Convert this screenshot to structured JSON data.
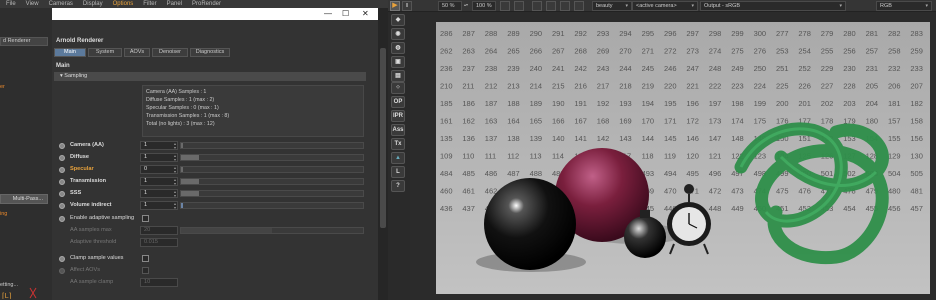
{
  "menubar": {
    "items": [
      {
        "label": "File",
        "active": false
      },
      {
        "label": "View",
        "active": false
      },
      {
        "label": "Cameras",
        "active": false
      },
      {
        "label": "Display",
        "active": false
      },
      {
        "label": "Options",
        "active": true
      },
      {
        "label": "Filter",
        "active": false
      },
      {
        "label": "Panel",
        "active": false
      },
      {
        "label": "ProRender",
        "active": false
      }
    ]
  },
  "left_strip": {
    "renderer_dropdown": "d Renderer",
    "orange_text_1": "er",
    "multipass_button": "Multi-Pass...",
    "orange_text_2": "ing",
    "bottom_text": "etting..."
  },
  "dialog": {
    "window_buttons": {
      "minimize": "—",
      "maximize": "☐",
      "close": "✕"
    },
    "title": "Arnold Renderer",
    "tabs": [
      {
        "label": "Main",
        "active": true
      },
      {
        "label": "System",
        "active": false
      },
      {
        "label": "AOVs",
        "active": false
      },
      {
        "label": "Denoiser",
        "active": false
      },
      {
        "label": "Diagnostics",
        "active": false
      }
    ],
    "main_label": "Main",
    "section_header": "▾ Sampling",
    "info_lines": [
      "Camera (AA) Samples : 1",
      "Diffuse Samples : 1 (max : 2)",
      "Specular Samples : 0 (max : 1)",
      "Transmission Samples : 1 (max : 8)",
      "Total (no lights) : 3 (max : 12)"
    ],
    "params": [
      {
        "label": "Camera (AA)",
        "value": "1",
        "fill": 0.0,
        "color": "gray"
      },
      {
        "label": "Diffuse",
        "value": "1",
        "fill": 0.1,
        "color": "gray"
      },
      {
        "label": "Specular",
        "value": "0",
        "fill": 0.0,
        "color": "gray"
      },
      {
        "label": "Transmission",
        "value": "1",
        "fill": 0.1,
        "color": "gray"
      },
      {
        "label": "SSS",
        "value": "1",
        "fill": 0.1,
        "color": "gray"
      },
      {
        "label": "Volume indirect",
        "value": "1",
        "fill": 0.01,
        "color": "blue"
      }
    ],
    "adaptive_label": "Enable adaptive sampling",
    "aa_samples_max_label": "AA samples max",
    "aa_samples_max_value": "20",
    "adaptive_threshold_label": "Adaptive threshold",
    "adaptive_threshold_value": "0.015",
    "clamp_label": "Clamp sample values",
    "affect_aovs_label": "Affect AOVs",
    "aa_sample_clamp_label": "AA sample clamp",
    "aa_sample_clamp_value": "10"
  },
  "viewer": {
    "zoom": "50 %",
    "zoom2": "100 %",
    "aov": "beauty",
    "camera": "<active camera>",
    "output": "Output - sRGB",
    "channel": "RGB",
    "side_buttons": [
      "OP",
      "IPR",
      "Ass",
      "Tx",
      "L",
      "?"
    ],
    "grid_numbers": [
      [
        "286",
        "287",
        "288",
        "289",
        "290",
        "291",
        "292",
        "293",
        "294",
        "295",
        "296",
        "297",
        "298",
        "299",
        "300",
        "277",
        "278",
        "279",
        "280",
        "281",
        "282",
        "283"
      ],
      [
        "262",
        "263",
        "264",
        "265",
        "266",
        "267",
        "268",
        "269",
        "270",
        "271",
        "272",
        "273",
        "274",
        "275",
        "276",
        "253",
        "254",
        "255",
        "256",
        "257",
        "258",
        "259"
      ],
      [
        "236",
        "237",
        "238",
        "239",
        "240",
        "241",
        "242",
        "243",
        "244",
        "245",
        "246",
        "247",
        "248",
        "249",
        "250",
        "251",
        "252",
        "229",
        "230",
        "231",
        "232",
        "233"
      ],
      [
        "210",
        "211",
        "212",
        "213",
        "214",
        "215",
        "216",
        "217",
        "218",
        "219",
        "220",
        "221",
        "222",
        "223",
        "224",
        "225",
        "226",
        "227",
        "228",
        "205",
        "206",
        "207"
      ],
      [
        "185",
        "186",
        "187",
        "188",
        "189",
        "190",
        "191",
        "192",
        "193",
        "194",
        "195",
        "196",
        "197",
        "198",
        "199",
        "200",
        "201",
        "202",
        "203",
        "204",
        "181",
        "182"
      ],
      [
        "161",
        "162",
        "163",
        "164",
        "165",
        "166",
        "167",
        "168",
        "169",
        "170",
        "171",
        "172",
        "173",
        "174",
        "175",
        "176",
        "177",
        "178",
        "179",
        "180",
        "157",
        "158"
      ],
      [
        "135",
        "136",
        "137",
        "138",
        "139",
        "140",
        "141",
        "142",
        "143",
        "144",
        "145",
        "146",
        "147",
        "148",
        "149",
        "150",
        "151",
        "152",
        "153",
        "154",
        "155",
        "156"
      ],
      [
        "109",
        "110",
        "111",
        "112",
        "113",
        "114",
        "115",
        "116",
        "117",
        "118",
        "119",
        "120",
        "121",
        "122",
        "123",
        "124",
        "125",
        "126",
        "127",
        "128",
        "129",
        "130"
      ],
      [
        "484",
        "485",
        "486",
        "487",
        "488",
        "489",
        "490",
        "491",
        "492",
        "493",
        "494",
        "495",
        "496",
        "497",
        "498",
        "499",
        "500",
        "501",
        "502",
        "503",
        "504",
        "505"
      ],
      [
        "460",
        "461",
        "462",
        "463",
        "464",
        "465",
        "466",
        "467",
        "468",
        "469",
        "470",
        "471",
        "472",
        "473",
        "474",
        "475",
        "476",
        "477",
        "478",
        "479",
        "480",
        "481"
      ],
      [
        "436",
        "437",
        "438",
        "439",
        "440",
        "441",
        "442",
        "443",
        "444",
        "445",
        "446",
        "447",
        "448",
        "449",
        "450",
        "451",
        "452",
        "453",
        "454",
        "455",
        "456",
        "457"
      ]
    ]
  },
  "colors": {
    "accent_orange": "#e8a23c",
    "tab_active": "#5c7a9c",
    "render_bg": "#a9a9a9",
    "sphere_black": "#111111",
    "sphere_magenta": "#7a1f3d",
    "knot_green": "#2f8f4a"
  }
}
